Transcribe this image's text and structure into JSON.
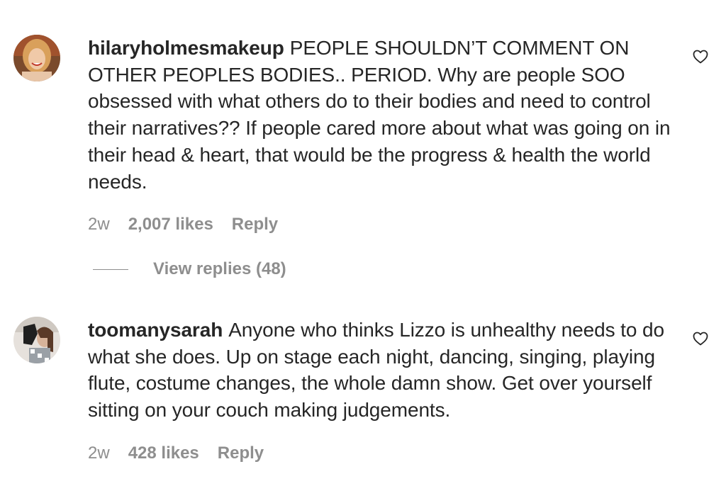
{
  "comments": [
    {
      "username": "hilaryholmesmakeup",
      "text": "PEOPLE SHOULDN’T COMMENT ON OTHER PEOPLES BODIES.. PERIOD. Why are people SOO obsessed with what others do to their bodies and need to control their narratives?? If people cared more about what was going on in their head & heart, that would be the progress & health the world needs.",
      "time": "2w",
      "likes": "2,007 likes",
      "reply_label": "Reply",
      "view_replies": "View replies (48)"
    },
    {
      "username": "toomanysarah",
      "text": "Anyone who thinks Lizzo is unhealthy needs to do what she does. Up on stage each night, dancing, singing, playing flute, costume changes, the whole damn show. Get over yourself sitting on your couch making judgements.",
      "time": "2w",
      "likes": "428 likes",
      "reply_label": "Reply"
    }
  ],
  "icons": {
    "like": "heart-outline-icon"
  },
  "colors": {
    "text": "#262626",
    "secondary": "#8e8e8e",
    "background": "#ffffff"
  }
}
